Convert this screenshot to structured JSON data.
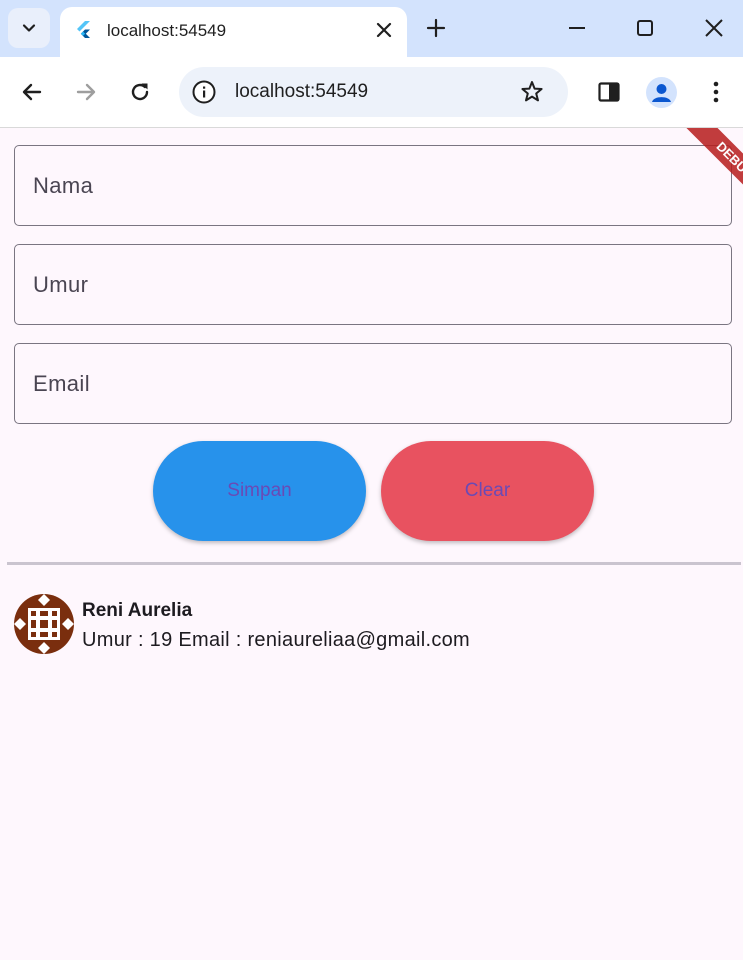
{
  "browser": {
    "tab_title": "localhost:54549",
    "url": "localhost:54549",
    "icons": {
      "tab_search": "chevron-down-icon",
      "favicon": "flutter-icon",
      "tab_close": "close-icon",
      "new_tab": "plus-icon",
      "minimize": "minimize-icon",
      "maximize": "maximize-icon",
      "close": "close-icon",
      "back": "arrow-left-icon",
      "forward": "arrow-right-icon",
      "reload": "reload-icon",
      "site_info": "info-icon",
      "bookmark": "star-icon",
      "side_panel": "side-panel-icon",
      "profile": "profile-icon",
      "menu": "more-vertical-icon"
    }
  },
  "form": {
    "nama_placeholder": "Nama",
    "umur_placeholder": "Umur",
    "email_placeholder": "Email",
    "simpan_label": "Simpan",
    "clear_label": "Clear"
  },
  "colors": {
    "simpan_button": "#2792eb",
    "clear_button": "#e85260",
    "button_text": "#6a4ab5",
    "background": "#fef7fd"
  },
  "list": {
    "items": [
      {
        "name": "Reni Aurelia",
        "umur_label": "Umur : ",
        "umur_value": "19",
        "email_label": " Email : ",
        "email_value": "reniaureliaa@gmail.com"
      }
    ]
  },
  "debug_banner": "DEBUG"
}
